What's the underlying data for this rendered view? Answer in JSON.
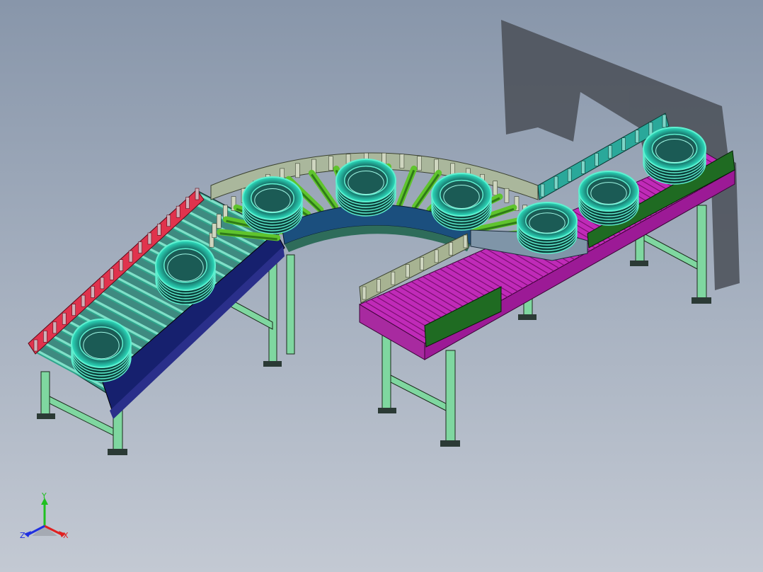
{
  "viewport": {
    "background_top": "#8896aa",
    "background_bottom": "#c3c9d3"
  },
  "model": {
    "description": "roller-conveyor-assembly-with-tires",
    "colors": {
      "red_rail": "#e0334d",
      "roller": "#2fa58c",
      "roller_light": "#7fe0c8",
      "navy_guard": "#16206e",
      "curve_roller": "#5fc42d",
      "curve_guard": "#1b4f7e",
      "rail_grey": "#9aa890",
      "belt_magenta": "#c02ab8",
      "side_green": "#1f6b22",
      "leg": "#7fd7a0",
      "tire": "#5ff0d0",
      "plate_grey": "#7f95a8",
      "rail_teal": "#2aa89a"
    },
    "tire_count": 8
  },
  "triad": {
    "x_label": "X",
    "y_label": "Y",
    "z_label": "Z",
    "x_color": "#e02020",
    "y_color": "#20c020",
    "z_color": "#2030e0"
  }
}
